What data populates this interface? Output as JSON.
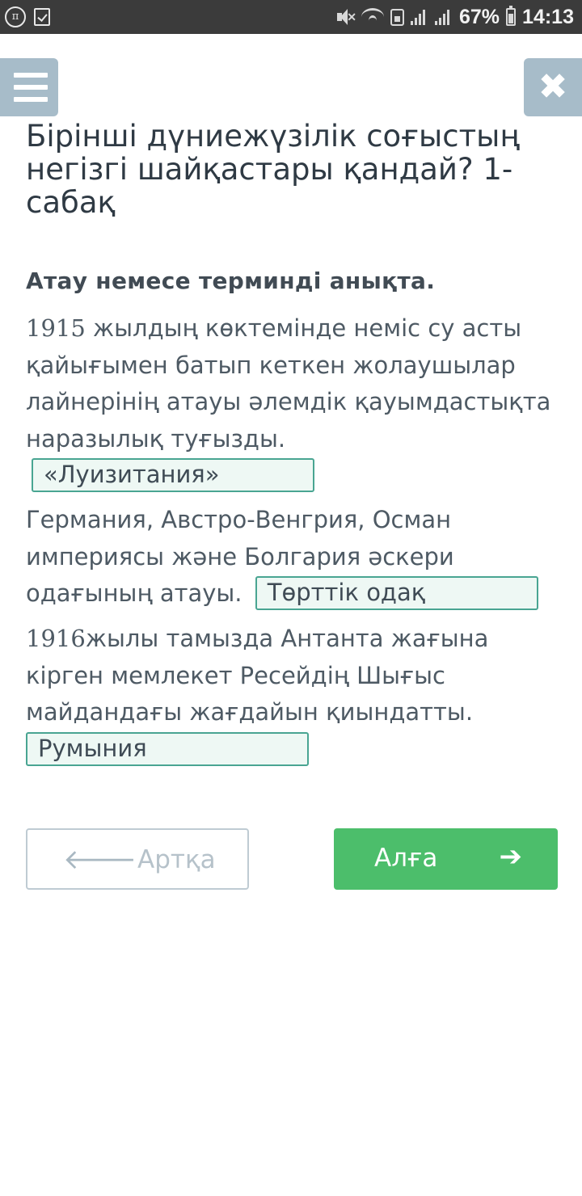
{
  "status_bar": {
    "battery_percent": "67%",
    "time": "14:13",
    "icons": [
      "pi-icon",
      "check-icon",
      "mute-icon",
      "wifi-icon",
      "sim-icon",
      "signal-icon",
      "signal-icon",
      "battery-icon"
    ]
  },
  "header": {
    "menu_icon": "hamburger-icon",
    "close_icon": "close-icon",
    "title": "Бірінші дүниежүзілік соғыстың негізгі шайқастары қандай? 1-сабақ"
  },
  "task": {
    "instruction": "Атау немесе терминді анықта.",
    "questions": [
      {
        "number": "1915",
        "text": " жылдың көктемінде неміс су асты қайығымен батып кеткен жолаушылар лайнерінің атауы әлемдік қауымдастықта наразылық туғызды.",
        "answer": "«Луизитания»"
      },
      {
        "number": "",
        "text": "Германия, Австро-Венгрия, Осман империясы және Болгария әскери одағының атауы.",
        "answer": "Төрттік одақ"
      },
      {
        "number": "1916",
        "text": "жылы тамызда Антанта жағына кірген мемлекет Ресейдің Шығыс майдандағы жағдайын қиындатты.",
        "answer": "Румыния"
      }
    ]
  },
  "navigation": {
    "back_label": "Артқа",
    "next_label": "Алға",
    "back_icon": "arrow-left-icon",
    "next_icon": "arrow-right-icon"
  },
  "colors": {
    "status_bar": "#3b3b3b",
    "header_buttons": "#a7bcc9",
    "answer_border": "#49a592",
    "answer_fill": "#eef8f4",
    "next_button": "#4cbe6b"
  }
}
